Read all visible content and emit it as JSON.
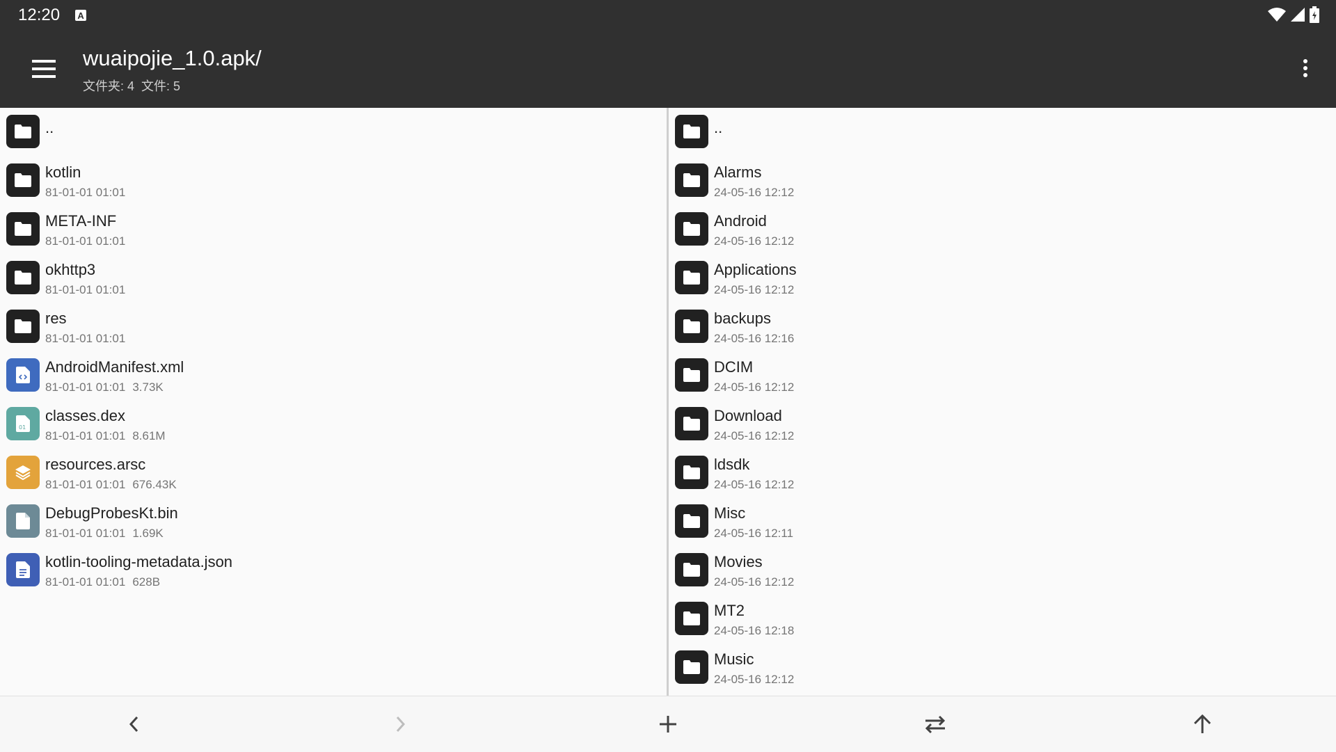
{
  "status_bar": {
    "time": "12:20",
    "indicator": "A"
  },
  "app_bar": {
    "title": "wuaipojie_1.0.apk/",
    "folders_label": "文件夹: 4",
    "files_label": "文件: 5"
  },
  "colors": {
    "bar_bg": "#303030",
    "folder_icon": "#212121",
    "xml_icon": "#3f6bbf",
    "dex_icon": "#5fa9a1",
    "arsc_icon": "#e3a33b",
    "bin_icon": "#6d8a96",
    "json_icon": "#3f5fb5"
  },
  "left_pane": {
    "up_label": "..",
    "items": [
      {
        "name": "kotlin",
        "date": "81-01-01 01:01",
        "size": "",
        "icon": "folder-icon"
      },
      {
        "name": "META-INF",
        "date": "81-01-01 01:01",
        "size": "",
        "icon": "folder-icon"
      },
      {
        "name": "okhttp3",
        "date": "81-01-01 01:01",
        "size": "",
        "icon": "folder-icon"
      },
      {
        "name": "res",
        "date": "81-01-01 01:01",
        "size": "",
        "icon": "folder-icon"
      },
      {
        "name": "AndroidManifest.xml",
        "date": "81-01-01 01:01",
        "size": "3.73K",
        "icon": "xml-file-icon"
      },
      {
        "name": "classes.dex",
        "date": "81-01-01 01:01",
        "size": "8.61M",
        "icon": "dex-file-icon"
      },
      {
        "name": "resources.arsc",
        "date": "81-01-01 01:01",
        "size": "676.43K",
        "icon": "layers-file-icon"
      },
      {
        "name": "DebugProbesKt.bin",
        "date": "81-01-01 01:01",
        "size": "1.69K",
        "icon": "generic-file-icon"
      },
      {
        "name": "kotlin-tooling-metadata.json",
        "date": "81-01-01 01:01",
        "size": "628B",
        "icon": "text-file-icon"
      }
    ]
  },
  "right_pane": {
    "up_label": "..",
    "items": [
      {
        "name": "Alarms",
        "date": "24-05-16 12:12"
      },
      {
        "name": "Android",
        "date": "24-05-16 12:12"
      },
      {
        "name": "Applications",
        "date": "24-05-16 12:12"
      },
      {
        "name": "backups",
        "date": "24-05-16 12:16"
      },
      {
        "name": "DCIM",
        "date": "24-05-16 12:12"
      },
      {
        "name": "Download",
        "date": "24-05-16 12:12"
      },
      {
        "name": "ldsdk",
        "date": "24-05-16 12:12"
      },
      {
        "name": "Misc",
        "date": "24-05-16 12:11"
      },
      {
        "name": "Movies",
        "date": "24-05-16 12:12"
      },
      {
        "name": "MT2",
        "date": "24-05-16 12:18"
      },
      {
        "name": "Music",
        "date": "24-05-16 12:12"
      }
    ]
  },
  "bottom_bar": {
    "buttons": [
      "back-arrow-icon",
      "forward-arrow-icon",
      "add-icon",
      "swap-icon",
      "up-arrow-icon"
    ]
  }
}
